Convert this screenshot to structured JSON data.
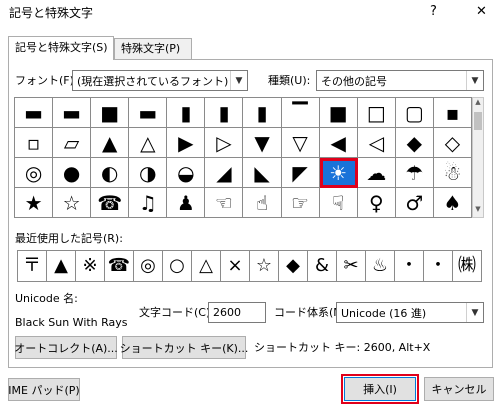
{
  "window": {
    "title": "記号と特殊文字",
    "help_label": "?",
    "close_label": "✕"
  },
  "tabs": [
    {
      "label": "記号と特殊文字(S)",
      "active": true
    },
    {
      "label": "特殊文字(P)",
      "active": false
    }
  ],
  "font": {
    "label": "フォント(F):",
    "value": "(現在選択されているフォント)"
  },
  "subset": {
    "label": "種類(U):",
    "value": "その他の記号"
  },
  "symbol_grid": {
    "selected_index": 32,
    "cells": [
      "▬",
      "▬",
      "■",
      "▬",
      "▮",
      "▮",
      "▮",
      "▔",
      "■",
      "□",
      "▢",
      "▪",
      "▫",
      "▱",
      "▲",
      "△",
      "▶",
      "▷",
      "▼",
      "▽",
      "◀",
      "◁",
      "◆",
      "◇",
      "◎",
      "●",
      "◐",
      "◑",
      "◒",
      "◢",
      "◣",
      "◤",
      "☀",
      "☁",
      "☂",
      "☃",
      "★",
      "☆",
      "☎",
      "♫",
      "♟",
      "☜",
      "☝",
      "☞",
      "☟",
      "♀",
      "♂",
      "♠",
      "♡",
      "♢",
      "♣",
      "♤"
    ]
  },
  "recent": {
    "label": "最近使用した記号(R):",
    "cells": [
      "〒",
      "▲",
      "※",
      "☎",
      "◎",
      "○",
      "△",
      "×",
      "☆",
      "◆",
      "&",
      "✂",
      "♨",
      "・",
      "・",
      "㈱"
    ]
  },
  "unicode_name": {
    "label": "Unicode 名:",
    "value": "Black Sun With Rays"
  },
  "char_code": {
    "label": "文字コード(C):",
    "value": "2600"
  },
  "code_system": {
    "label": "コード体系(M):",
    "value": "Unicode (16 進)"
  },
  "buttons": {
    "autocorrect": "オートコレクト(A)...",
    "shortcut_key": "ショートカット キー(K)...",
    "ime_pad": "IME パッド(P)",
    "insert": "挿入(I)",
    "cancel": "キャンセル"
  },
  "shortcut_info": "ショートカット キー: 2600, Alt+X"
}
